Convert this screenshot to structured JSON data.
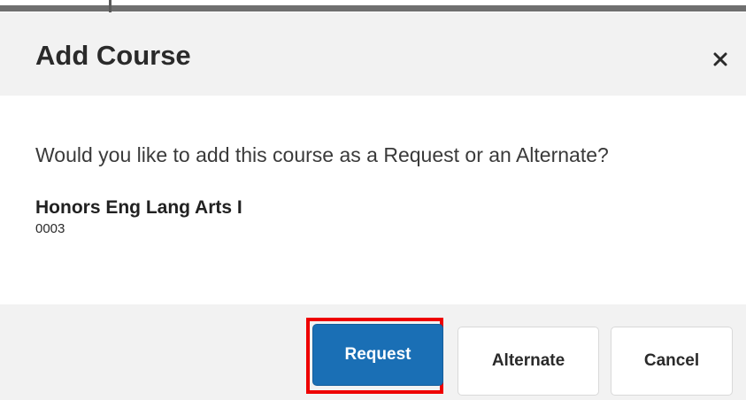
{
  "dialog": {
    "title": "Add Course",
    "close_symbol": "×",
    "close_icon": "close-icon"
  },
  "body": {
    "prompt": "Would you like to add this course as a Request or an Alternate?",
    "course": {
      "name": "Honors Eng Lang Arts I",
      "number": "0003"
    }
  },
  "footer": {
    "buttons": {
      "request": "Request",
      "alternate": "Alternate",
      "cancel": "Cancel"
    }
  },
  "colors": {
    "primary_button": "#1a6fb5",
    "highlight_outline": "#ee0000",
    "header_footer_background": "#f2f2f2"
  }
}
